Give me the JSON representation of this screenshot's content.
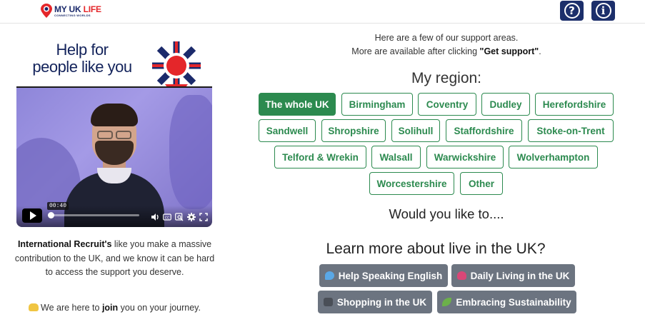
{
  "header": {
    "logo_main": "MY UK",
    "logo_accent": "LIFE",
    "logo_sub": "CONNECTING WORLDS",
    "help_symbol": "?",
    "info_symbol": "i",
    "help_icon": "question-circle-icon",
    "info_icon": "info-circle-icon"
  },
  "banner": {
    "line1": "Help for",
    "line2": "people like you"
  },
  "video": {
    "time_tooltip": "00:40",
    "progress_fraction": 0.0,
    "icons": [
      "play-icon",
      "volume-icon",
      "captions-icon",
      "search-icon",
      "settings-icon",
      "fullscreen-icon"
    ]
  },
  "intro": {
    "bold": "International Recruit's",
    "rest": " like you make a massive contribution to the UK, and we know it can be hard to access the support you deserve."
  },
  "join": {
    "before": "We are here to ",
    "bold": "join",
    "after": " you on your journey."
  },
  "support": {
    "line1": "Here are a few of our support areas.",
    "line2_before": "More are available after clicking ",
    "line2_bold": "\"Get support\"",
    "line2_after": "."
  },
  "region": {
    "title": "My region:",
    "items": [
      "The whole UK",
      "Birmingham",
      "Coventry",
      "Dudley",
      "Herefordshire",
      "Sandwell",
      "Shropshire",
      "Solihull",
      "Staffordshire",
      "Stoke-on-Trent",
      "Telford & Wrekin",
      "Walsall",
      "Warwickshire",
      "Wolverhampton",
      "Worcestershire",
      "Other"
    ],
    "active": "The whole UK"
  },
  "would_text": "Would you like to....",
  "learn_title": "Learn more about live in the UK?",
  "actions": [
    {
      "label": "Help Speaking English",
      "icon": "speech-bubble-icon"
    },
    {
      "label": "Daily Living in the UK",
      "icon": "heart-icon"
    },
    {
      "label": "Shopping in the UK",
      "icon": "shopping-cart-icon"
    },
    {
      "label": "Embracing Sustainability",
      "icon": "leaf-icon"
    }
  ],
  "colors": {
    "navy": "#1c2f6b",
    "green": "#2c8a4f",
    "grey_button": "#6c7480",
    "red": "#e4262a"
  }
}
